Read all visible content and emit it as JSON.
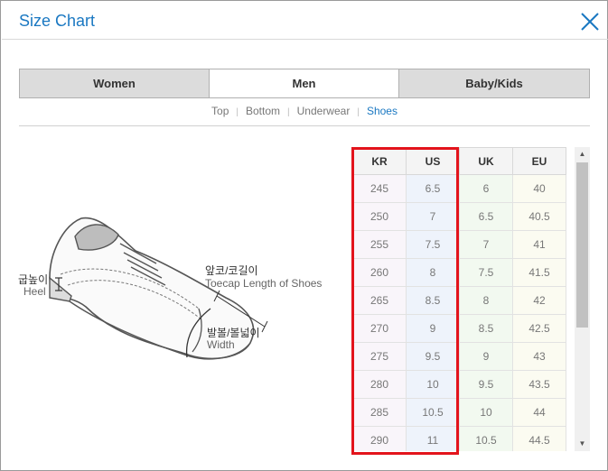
{
  "dialog": {
    "title": "Size Chart"
  },
  "tabs": [
    {
      "label": "Women"
    },
    {
      "label": "Men"
    },
    {
      "label": "Baby/Kids"
    }
  ],
  "subnav": [
    {
      "label": "Top"
    },
    {
      "label": "Bottom"
    },
    {
      "label": "Underwear"
    },
    {
      "label": "Shoes"
    }
  ],
  "subnav_separator": "|",
  "illustration": {
    "heel_ko": "굽높이",
    "heel_en": "Heel",
    "toecap_ko": "앞코/코길이",
    "toecap_en": "Toecap Length of Shoes",
    "width_ko": "발볼/볼넓이",
    "width_en": "Width"
  },
  "size_table": {
    "headers": [
      "KR",
      "US",
      "UK",
      "EU"
    ],
    "rows": [
      [
        "245",
        "6.5",
        "6",
        "40"
      ],
      [
        "250",
        "7",
        "6.5",
        "40.5"
      ],
      [
        "255",
        "7.5",
        "7",
        "41"
      ],
      [
        "260",
        "8",
        "7.5",
        "41.5"
      ],
      [
        "265",
        "8.5",
        "8",
        "42"
      ],
      [
        "270",
        "9",
        "8.5",
        "42.5"
      ],
      [
        "275",
        "9.5",
        "9",
        "43"
      ],
      [
        "280",
        "10",
        "9.5",
        "43.5"
      ],
      [
        "285",
        "10.5",
        "10",
        "44"
      ],
      [
        "290",
        "11",
        "10.5",
        "44.5"
      ]
    ]
  },
  "colors": {
    "accent": "#1a78c2",
    "highlight_border": "#e3141c"
  },
  "icons": {
    "close": "close-icon",
    "scroll_up": "scroll-up-arrow-icon",
    "scroll_down": "scroll-down-arrow-icon"
  }
}
